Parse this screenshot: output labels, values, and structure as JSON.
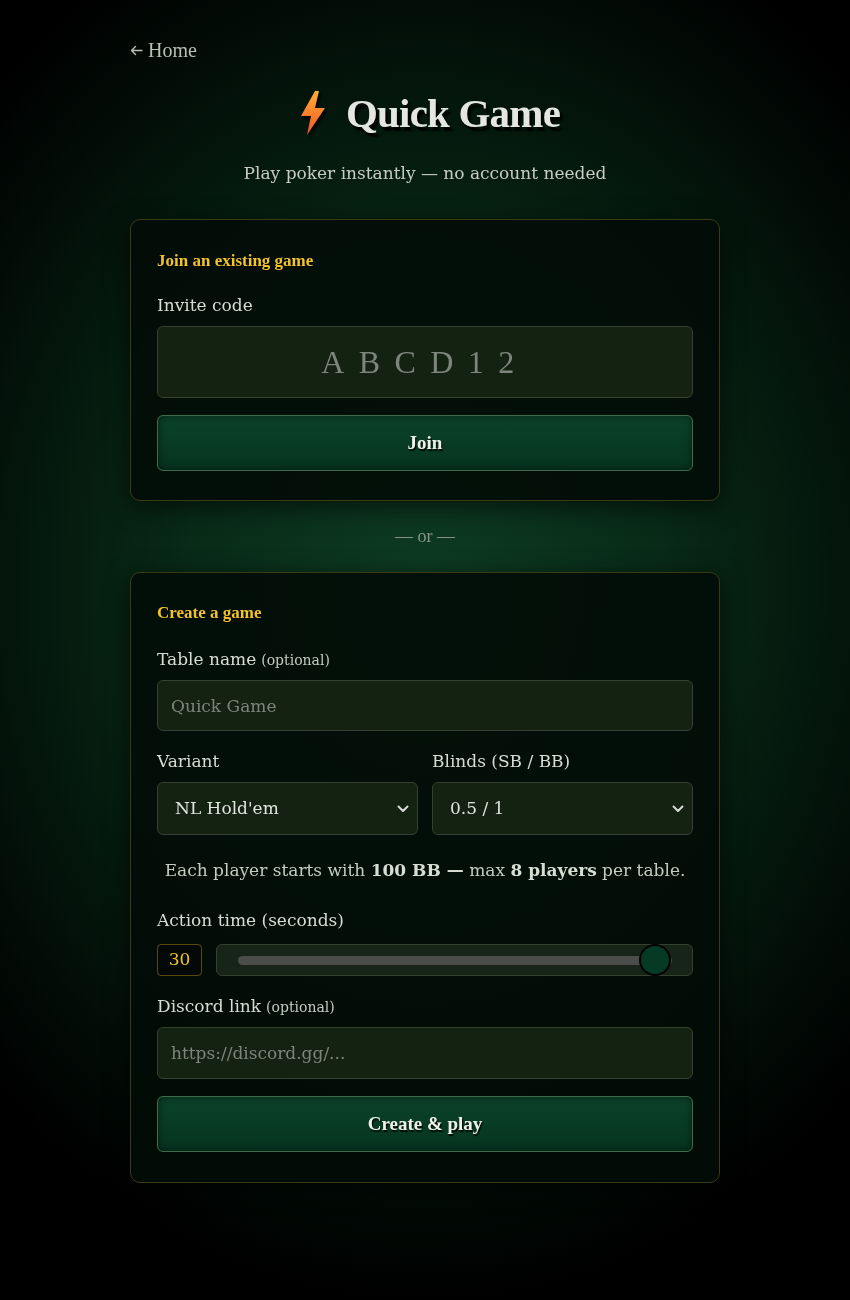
{
  "nav": {
    "back_link": "Home"
  },
  "header": {
    "title": "Quick Game",
    "subtitle": "Play poker instantly — no account needed"
  },
  "join_card": {
    "heading": "Join an existing game",
    "invite_code": {
      "label": "Invite code",
      "placeholder": "ABCD12"
    },
    "button": "Join"
  },
  "divider": "— or —",
  "create_card": {
    "heading": "Create a game",
    "table_name": {
      "label": "Table name",
      "note": "(optional)",
      "placeholder": "Quick Game"
    },
    "variant": {
      "label": "Variant",
      "value": "NL Hold'em"
    },
    "blinds": {
      "label": "Blinds (SB / BB)",
      "value": "0.5 / 1"
    },
    "info": "Each player starts with **100 BB —** max **8 players** per table.",
    "action_time": {
      "label": "Action time (seconds)",
      "value": "30",
      "level": 0.96
    },
    "discord": {
      "label": "Discord link",
      "note": "(optional)",
      "placeholder": "https://discord.gg/..."
    },
    "button": "Create & play"
  }
}
